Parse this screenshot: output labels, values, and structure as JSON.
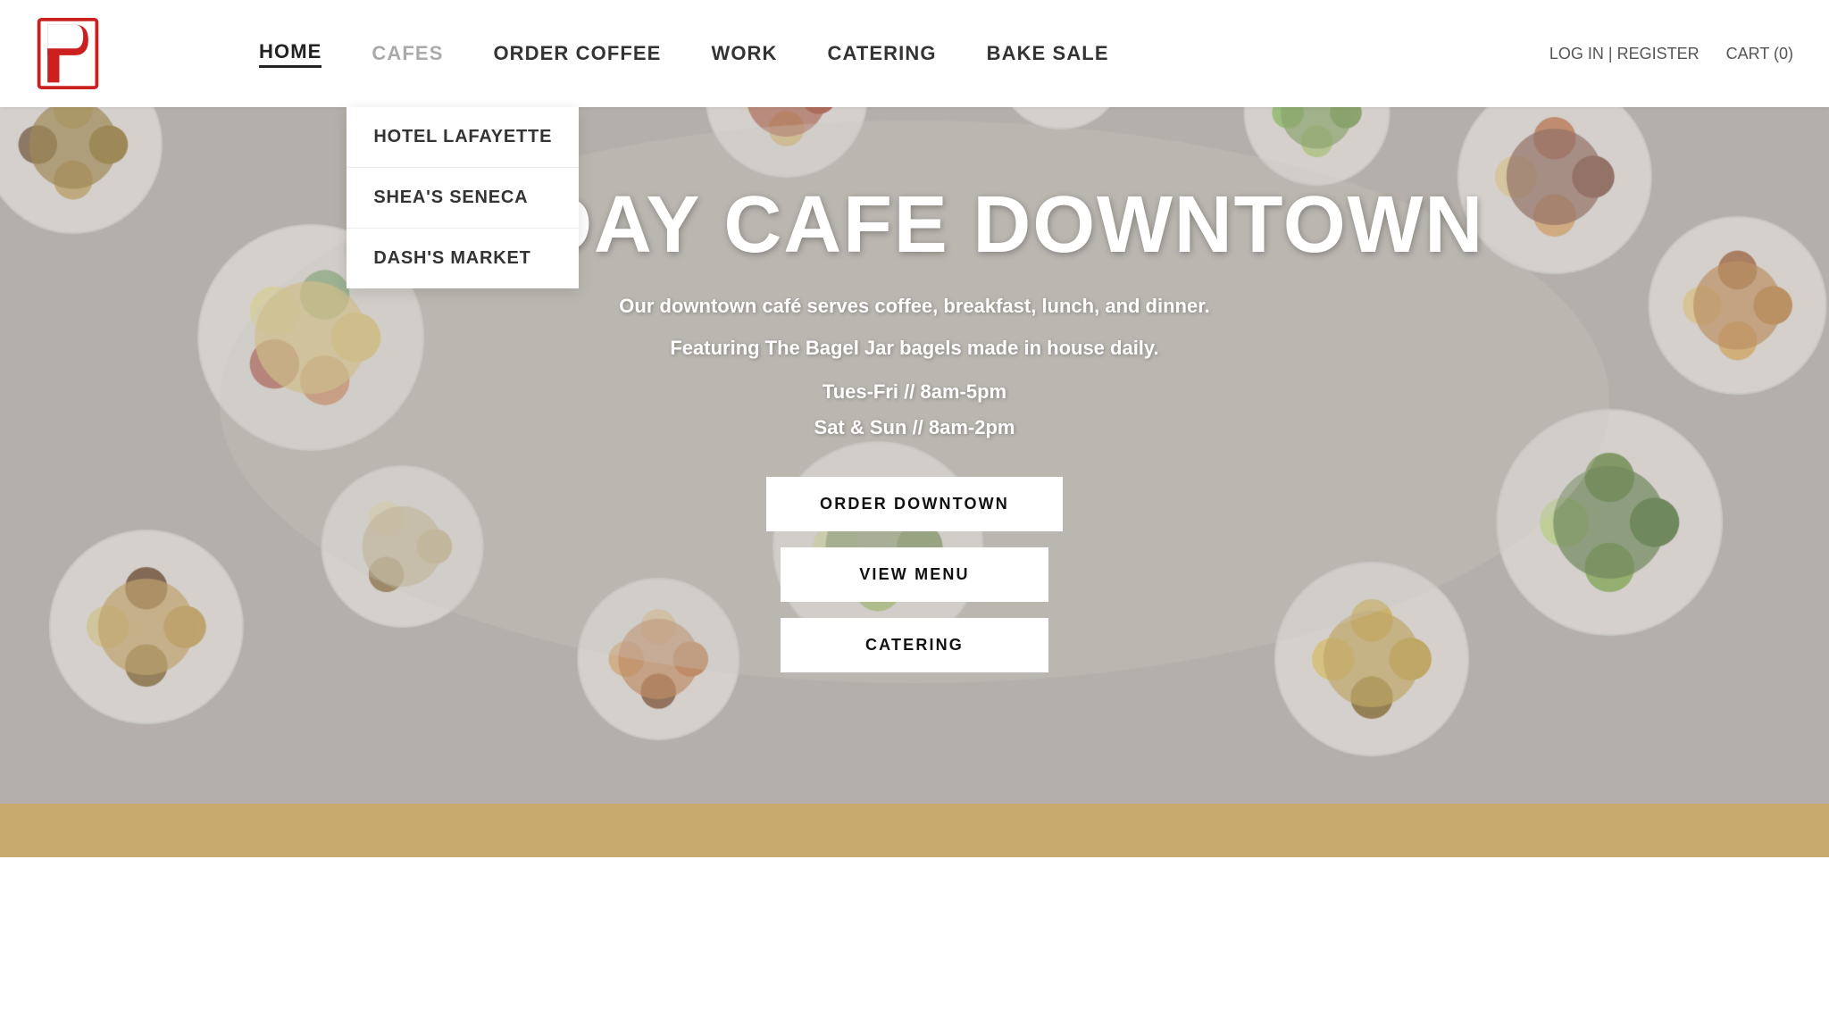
{
  "brand": {
    "logo_letter": "P",
    "logo_color": "#cc1f1f"
  },
  "navbar": {
    "items": [
      {
        "id": "home",
        "label": "HOME",
        "active": true
      },
      {
        "id": "cafes",
        "label": "CAFES",
        "active": false,
        "has_dropdown": true
      },
      {
        "id": "order-coffee",
        "label": "ORDER COFFEE",
        "active": false
      },
      {
        "id": "work",
        "label": "WORK",
        "active": false
      },
      {
        "id": "catering",
        "label": "CATERING",
        "active": false
      },
      {
        "id": "bake-sale",
        "label": "BAKE SALE",
        "active": false
      }
    ],
    "auth": "LOG IN | REGISTER",
    "cart": "CART (0)"
  },
  "cafes_dropdown": {
    "items": [
      {
        "id": "hotel-lafayette",
        "label": "HOTEL LAFAYETTE"
      },
      {
        "id": "sheas-seneca",
        "label": "SHEA'S SENECA"
      },
      {
        "id": "dashs-market",
        "label": "DASH'S MARKET"
      }
    ]
  },
  "hero": {
    "title": "ALL-DAY CAFE DOWNTOWN",
    "subtitle_line1": "Our downtown café serves coffee, breakfast, lunch, and dinner.",
    "subtitle_line2": "Featuring The Bagel Jar bagels made in house daily.",
    "hours_line1": "Tues-Fri // 8am-5pm",
    "hours_line2": "Sat & Sun // 8am-2pm",
    "buttons": [
      {
        "id": "order-downtown",
        "label": "ORDER DOWNTOWN"
      },
      {
        "id": "view-menu",
        "label": "VIEW MENU"
      },
      {
        "id": "catering",
        "label": "CATERING"
      }
    ]
  }
}
